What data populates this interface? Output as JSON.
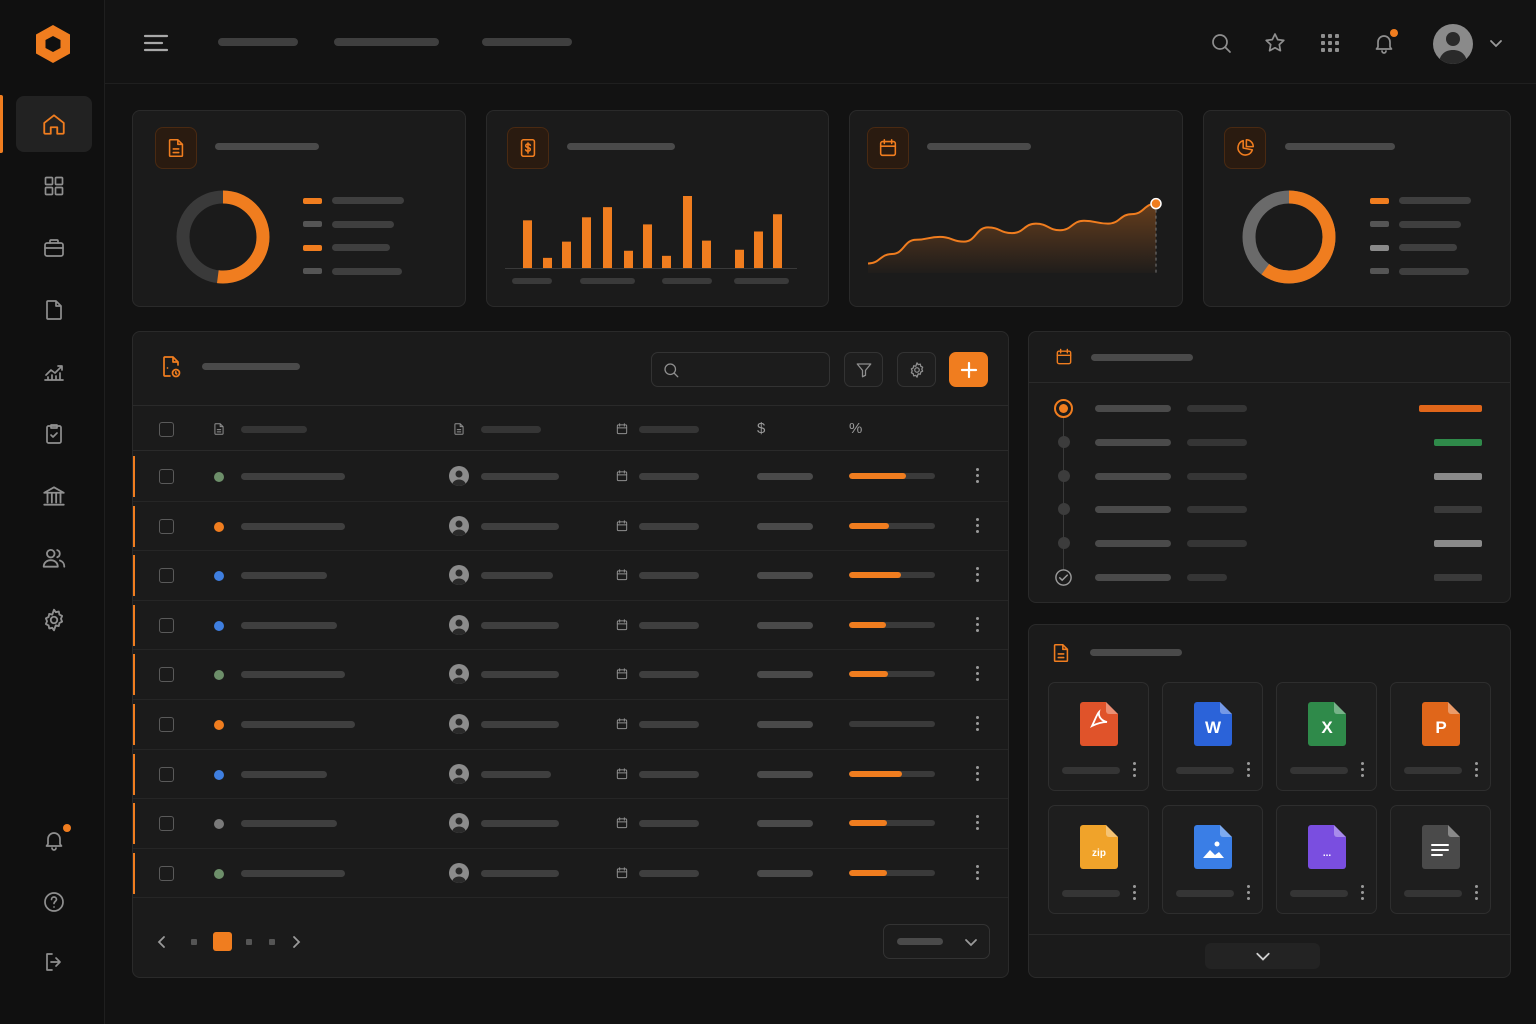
{
  "brand": {
    "accent": "#f07d1f",
    "background": "#121212",
    "card": "#1b1b1b"
  },
  "sidebar": {
    "logo": "hexagon-logo",
    "items": [
      {
        "icon": "home-icon",
        "active": true
      },
      {
        "icon": "grid-icon",
        "active": false
      },
      {
        "icon": "briefcase-icon",
        "active": false
      },
      {
        "icon": "document-icon",
        "active": false
      },
      {
        "icon": "chart-line-icon",
        "active": false
      },
      {
        "icon": "clipboard-check-icon",
        "active": false
      },
      {
        "icon": "bank-icon",
        "active": false
      },
      {
        "icon": "users-icon",
        "active": false
      },
      {
        "icon": "gear-icon",
        "active": false
      }
    ],
    "bottom_items": [
      {
        "icon": "bell-icon",
        "has_notification": true
      },
      {
        "icon": "help-icon"
      },
      {
        "icon": "logout-icon"
      }
    ]
  },
  "topbar": {
    "menu_icon": "hamburger-icon",
    "actions": [
      "search-icon",
      "star-icon",
      "apps-grid-icon",
      "bell-icon"
    ],
    "bell_has_notification": true,
    "avatar": "user-avatar"
  },
  "stat_cards": [
    {
      "icon": "document-icon",
      "type": "donut",
      "value_fraction": 0.52,
      "legend_colors": [
        "#f07d1f",
        "#555555",
        "#f07d1f",
        "#555555"
      ]
    },
    {
      "icon": "dollar-doc-icon",
      "type": "bar"
    },
    {
      "icon": "calendar-icon",
      "type": "area"
    },
    {
      "icon": "pie-icon",
      "type": "donut",
      "value_fraction": 0.6,
      "legend_colors": [
        "#f07d1f",
        "#555555",
        "#8a8a8a",
        "#555555"
      ]
    }
  ],
  "chart_data": [
    {
      "type": "bar",
      "values": [
        47,
        10,
        26,
        50,
        60,
        17,
        43,
        12,
        71,
        27,
        18,
        36,
        53
      ],
      "series_colors": [
        "#f07d1f"
      ]
    },
    {
      "type": "area",
      "values": [
        10,
        20,
        35,
        38,
        33,
        48,
        42,
        52,
        45,
        55,
        52,
        62,
        73
      ],
      "series_colors": [
        "#f07d1f"
      ]
    }
  ],
  "table": {
    "icon": "file-badge-icon",
    "search_icon": "search-icon",
    "tools": [
      "filter-icon",
      "gear-icon",
      "plus-icon"
    ],
    "columns": [
      "checkbox",
      "document-icon",
      "document-icon",
      "calendar-icon",
      "$",
      "%"
    ],
    "rows": [
      {
        "status_color": "#6d8f6a",
        "progress": 0.66
      },
      {
        "status_color": "#f07d1f",
        "progress": 0.46
      },
      {
        "status_color": "#3f7fe0",
        "progress": 0.61
      },
      {
        "status_color": "#3f7fe0",
        "progress": 0.43
      },
      {
        "status_color": "#6d8f6a",
        "progress": 0.45
      },
      {
        "status_color": "#f07d1f",
        "progress": 0.0
      },
      {
        "status_color": "#3f7fe0",
        "progress": 0.62
      },
      {
        "status_color": "#7a7a7a",
        "progress": 0.44
      },
      {
        "status_color": "#6d8f6a",
        "progress": 0.44
      }
    ],
    "pagination": {
      "current_page": 2,
      "pages": 4
    },
    "page_size_select": "chevron-down-icon"
  },
  "timeline": {
    "icon": "calendar-icon",
    "items": [
      {
        "state": "active",
        "tag_color": "#e0661a"
      },
      {
        "state": "pending",
        "tag_color": "#2f8a4a"
      },
      {
        "state": "pending",
        "tag_color": "#8a8a8a"
      },
      {
        "state": "pending",
        "tag_color": "#3a3a3a"
      },
      {
        "state": "pending",
        "tag_color": "#8a8a8a"
      },
      {
        "state": "done",
        "tag_color": "#3a3a3a"
      }
    ]
  },
  "files": {
    "icon": "document-icon",
    "items": [
      {
        "icon": "pdf-file-icon",
        "color": "#e0532a",
        "glyph": ""
      },
      {
        "icon": "word-file-icon",
        "color": "#2b63d9",
        "glyph": "W"
      },
      {
        "icon": "excel-file-icon",
        "color": "#2f8a4a",
        "glyph": "X"
      },
      {
        "icon": "powerpoint-file-icon",
        "color": "#e0661a",
        "glyph": "P"
      },
      {
        "icon": "zip-file-icon",
        "color": "#f0a32a",
        "glyph": "zip"
      },
      {
        "icon": "image-file-icon",
        "color": "#3a7ee6",
        "glyph": ""
      },
      {
        "icon": "other-file-icon",
        "color": "#7a4ee0",
        "glyph": "..."
      },
      {
        "icon": "text-file-icon",
        "color": "#4a4a4a",
        "glyph": ""
      }
    ],
    "expand_icon": "chevron-down-icon"
  }
}
